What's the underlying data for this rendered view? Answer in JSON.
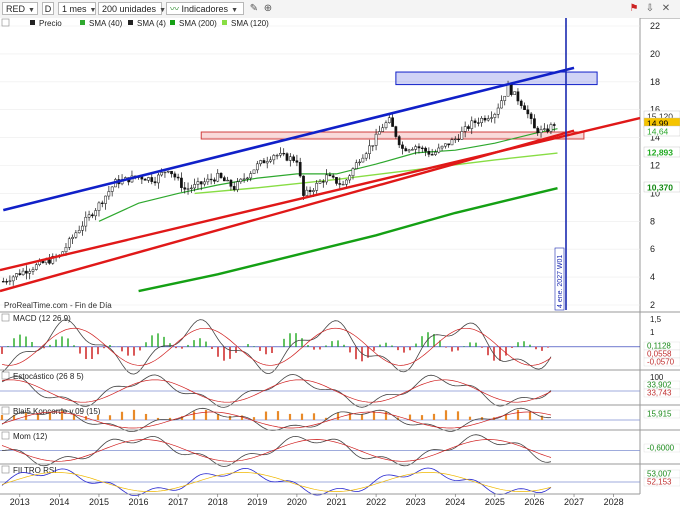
{
  "toolbar": {
    "symbol": "RED",
    "toggle": "D",
    "period": "1 mes",
    "units": "200 unidades",
    "indicators": "Indicadores"
  },
  "legend": {
    "price": "Precio",
    "sma40": "SMA (40)",
    "sma4": "SMA (4)",
    "sma200": "SMA (200)",
    "sma120": "SMA (120)"
  },
  "colors": {
    "channel_upper": "#1020c8",
    "support_red": "#e01818",
    "sma40": "#2ea82e",
    "sma200": "#14a014",
    "sma120": "#88dd44",
    "vline": "#1a2ab0",
    "panel_sep": "#9a9a9a"
  },
  "watermark": "ProRealTime.com - Fin de Día",
  "vertical_line_label": "4 ene. 2027 W01",
  "price_axis": {
    "ticks": [
      "22",
      "20",
      "18",
      "16",
      "14",
      "12",
      "10",
      "8",
      "6",
      "4",
      "2"
    ],
    "badges": [
      {
        "text": "15,120",
        "color": "#ffffff",
        "fg": "#333"
      },
      {
        "text": "14,99",
        "color": "#f5c400",
        "fg": "#000"
      },
      {
        "text": "14,64",
        "color": "#ffffff",
        "fg": "#2ea82e"
      },
      {
        "text": "12,893",
        "color": "#ffffff",
        "fg": "#22aa22"
      },
      {
        "text": "10,370",
        "color": "#ffffff",
        "fg": "#118811"
      }
    ]
  },
  "x_axis": {
    "years": [
      "2013",
      "2014",
      "2015",
      "2016",
      "2017",
      "2018",
      "2019",
      "2020",
      "2021",
      "2022",
      "2023",
      "2024",
      "2025",
      "2026",
      "2027",
      "2028"
    ]
  },
  "chart_data": {
    "type": "line",
    "title": "",
    "ylim": [
      2,
      22
    ],
    "x_range": [
      "2012-07",
      "2028-09"
    ],
    "series": [
      {
        "name": "Precio",
        "type": "candlestick",
        "x": [
          "2012-08",
          "2013-01",
          "2013-06",
          "2014-01",
          "2014-06",
          "2015-01",
          "2015-06",
          "2016-01",
          "2016-06",
          "2016-10",
          "2017-03",
          "2017-06",
          "2018-01",
          "2018-06",
          "2019-01",
          "2019-06",
          "2020-01",
          "2020-03",
          "2020-10",
          "2021-03",
          "2021-08",
          "2021-12",
          "2022-03",
          "2022-05",
          "2022-09",
          "2023-01",
          "2023-06",
          "2024-01",
          "2024-06",
          "2025-01",
          "2025-05",
          "2025-10",
          "2026-01",
          "2026-04",
          "2026-07"
        ],
        "y": [
          3.7,
          4.3,
          4.8,
          5.5,
          7.2,
          9.2,
          10.8,
          11.2,
          11.0,
          11.8,
          10.3,
          10.5,
          11.2,
          10.4,
          12.0,
          12.8,
          12.4,
          9.8,
          11.2,
          10.6,
          12.5,
          13.6,
          14.8,
          15.2,
          13.2,
          13.4,
          12.8,
          13.9,
          15.0,
          15.8,
          17.6,
          16.2,
          14.6,
          14.4,
          14.99
        ]
      },
      {
        "name": "SMA (40)",
        "x": [
          "2015-01",
          "2016-01",
          "2017-01",
          "2018-01",
          "2019-01",
          "2020-01",
          "2021-01",
          "2022-01",
          "2023-01",
          "2024-01",
          "2025-01",
          "2026-01",
          "2026-08"
        ],
        "y": [
          8.0,
          9.3,
          10.0,
          10.6,
          11.1,
          11.4,
          11.4,
          12.1,
          12.9,
          13.1,
          13.6,
          14.3,
          14.64
        ]
      },
      {
        "name": "SMA (120)",
        "x": [
          "2017-06",
          "2019-01",
          "2021-01",
          "2023-01",
          "2025-01",
          "2026-08"
        ],
        "y": [
          10.0,
          10.4,
          11.0,
          11.7,
          12.4,
          12.89
        ]
      },
      {
        "name": "SMA (200)",
        "x": [
          "2016-01",
          "2018-01",
          "2020-01",
          "2022-01",
          "2024-01",
          "2026-08"
        ],
        "y": [
          3.0,
          4.2,
          5.6,
          7.0,
          8.6,
          10.37
        ]
      }
    ],
    "trendlines": [
      {
        "name": "channel-upper",
        "x": [
          "2012-08",
          "2027-01"
        ],
        "y": [
          8.8,
          19.0
        ]
      },
      {
        "name": "support-red-1",
        "x": [
          "2012-07",
          "2028-09"
        ],
        "y": [
          4.5,
          15.4
        ]
      },
      {
        "name": "support-red-2",
        "x": [
          "2012-07",
          "2027-01"
        ],
        "y": [
          3.0,
          14.5
        ]
      }
    ],
    "zones": [
      {
        "name": "resistance-zone",
        "x": [
          "2022-07",
          "2027-08"
        ],
        "y": [
          17.8,
          18.7
        ]
      },
      {
        "name": "support-zone",
        "x": [
          "2017-08",
          "2027-04"
        ],
        "y": [
          13.9,
          14.4
        ]
      }
    ],
    "indicators": [
      {
        "name": "MACD (12 26 9)",
        "axis": [
          "1,5",
          "1",
          "0,5",
          "0"
        ],
        "values": [
          "0,1128",
          "0,0558",
          "-0,0570"
        ]
      },
      {
        "name": "Estocástico (26 8 5)",
        "axis": [
          "100"
        ],
        "values": [
          "33,902",
          "33,743"
        ]
      },
      {
        "name": "Blai5 Koncorde v.09 (15)",
        "axis": [],
        "values": [
          "15,915"
        ]
      },
      {
        "name": "Mom (12)",
        "axis": [],
        "values": [
          "-0,6000"
        ]
      },
      {
        "name": "FILTRO RSI",
        "axis": [],
        "values": [
          "53,007",
          "52,153"
        ]
      }
    ]
  }
}
